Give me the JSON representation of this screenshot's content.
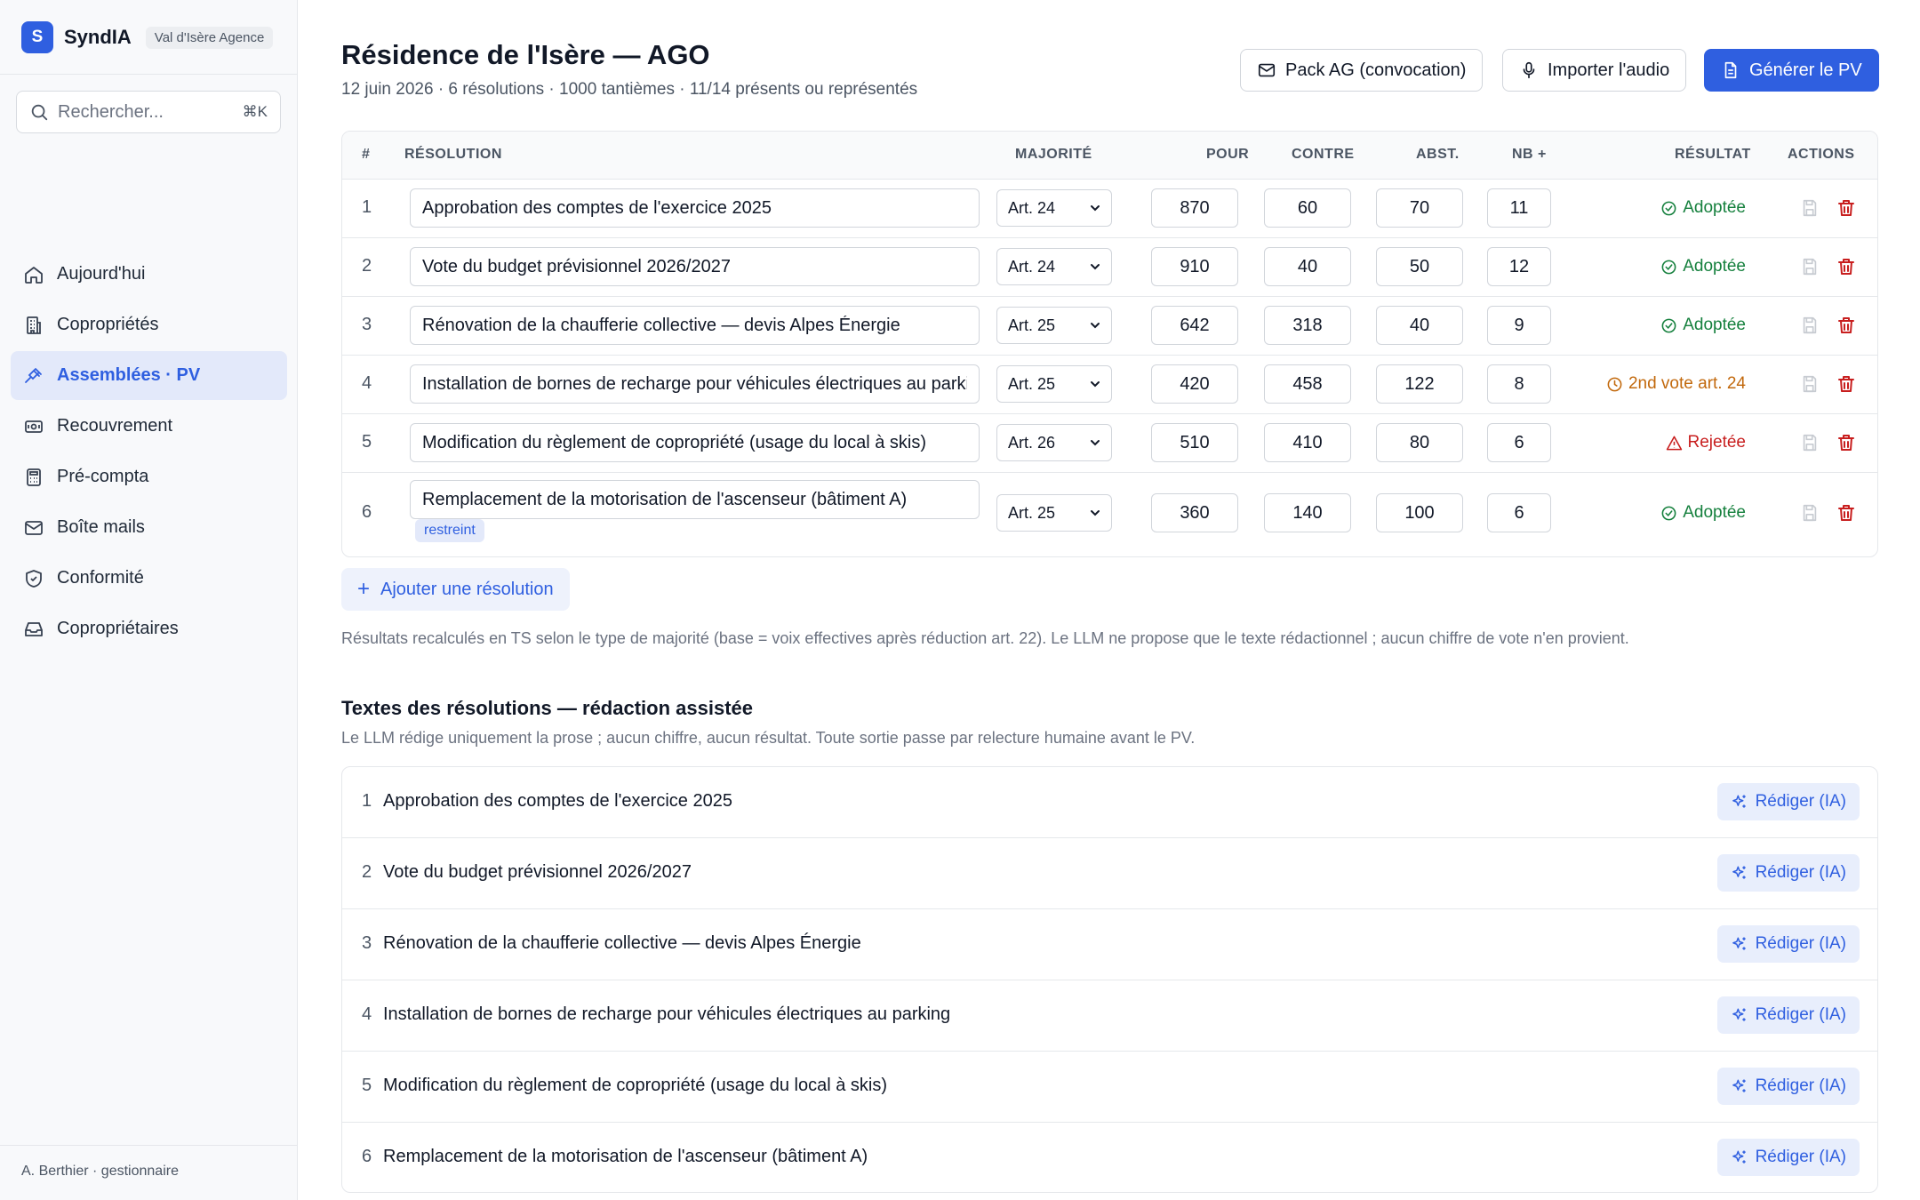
{
  "app": {
    "logo_letter": "S",
    "name": "SyndIA",
    "agency": "Val d'Isère Agence"
  },
  "search": {
    "placeholder": "Rechercher...",
    "shortcut": "⌘K"
  },
  "nav": [
    {
      "label": "Aujourd'hui",
      "icon": "home-icon"
    },
    {
      "label": "Copropriétés",
      "icon": "building-icon"
    },
    {
      "label": "Assemblées · PV",
      "icon": "gavel-icon",
      "active": true
    },
    {
      "label": "Recouvrement",
      "icon": "banknote-icon"
    },
    {
      "label": "Pré-compta",
      "icon": "calculator-icon"
    },
    {
      "label": "Boîte mails",
      "icon": "mail-icon"
    },
    {
      "label": "Conformité",
      "icon": "shield-icon"
    },
    {
      "label": "Copropriétaires",
      "icon": "inbox-icon"
    }
  ],
  "user": "A. Berthier · gestionnaire",
  "header": {
    "title": "Résidence de l'Isère — AGO",
    "subtitle": "12 juin 2026 · 6 résolutions · 1000 tantièmes · 11/14 présents ou représentés",
    "btn_pack": "Pack AG (convocation)",
    "btn_import": "Importer l'audio",
    "btn_generate": "Générer le PV"
  },
  "table": {
    "headers": {
      "num": "#",
      "resolution": "RÉSOLUTION",
      "majorite": "MAJORITÉ",
      "pour": "POUR",
      "contre": "CONTRE",
      "abst": "ABST.",
      "nb": "NB +",
      "resultat": "RÉSULTAT",
      "actions": "ACTIONS"
    },
    "rows": [
      {
        "num": "1",
        "text": "Approbation des comptes de l'exercice 2025",
        "majorite": "Art. 24",
        "pour": "870",
        "contre": "60",
        "abst": "70",
        "nb": "11",
        "result": "Adoptée",
        "status": "adopted"
      },
      {
        "num": "2",
        "text": "Vote du budget prévisionnel 2026/2027",
        "majorite": "Art. 24",
        "pour": "910",
        "contre": "40",
        "abst": "50",
        "nb": "12",
        "result": "Adoptée",
        "status": "adopted"
      },
      {
        "num": "3",
        "text": "Rénovation de la chaufferie collective — devis Alpes Énergie",
        "majorite": "Art. 25",
        "pour": "642",
        "contre": "318",
        "abst": "40",
        "nb": "9",
        "result": "Adoptée",
        "status": "adopted"
      },
      {
        "num": "4",
        "text": "Installation de bornes de recharge pour véhicules électriques au parking",
        "majorite": "Art. 25",
        "pour": "420",
        "contre": "458",
        "abst": "122",
        "nb": "8",
        "result": "2nd vote art. 24",
        "status": "second-vote"
      },
      {
        "num": "5",
        "text": "Modification du règlement de copropriété (usage du local à skis)",
        "majorite": "Art. 26",
        "pour": "510",
        "contre": "410",
        "abst": "80",
        "nb": "6",
        "result": "Rejetée",
        "status": "rejected"
      },
      {
        "num": "6",
        "text": "Remplacement de la motorisation de l'ascenseur (bâtiment A)",
        "majorite": "Art. 25",
        "pour": "360",
        "contre": "140",
        "abst": "100",
        "nb": "6",
        "result": "Adoptée",
        "status": "adopted",
        "tag": "restreint"
      }
    ]
  },
  "add_resolution": "Ajouter une résolution",
  "note": "Résultats recalculés en TS selon le type de majorité (base = voix effectives après réduction art. 22). Le LLM ne propose que le texte rédactionnel ; aucun chiffre de vote n'en provient.",
  "drafting": {
    "title": "Textes des résolutions — rédaction assistée",
    "subtitle": "Le LLM rédige uniquement la prose ; aucun chiffre, aucun résultat. Toute sortie passe par relecture humaine avant le PV.",
    "button_label": "Rédiger (IA)",
    "items": [
      {
        "num": "1",
        "text": "Approbation des comptes de l'exercice 2025"
      },
      {
        "num": "2",
        "text": "Vote du budget prévisionnel 2026/2027"
      },
      {
        "num": "3",
        "text": "Rénovation de la chaufferie collective — devis Alpes Énergie"
      },
      {
        "num": "4",
        "text": "Installation de bornes de recharge pour véhicules électriques au parking"
      },
      {
        "num": "5",
        "text": "Modification du règlement de copropriété (usage du local à skis)"
      },
      {
        "num": "6",
        "text": "Remplacement de la motorisation de l'ascenseur (bâtiment A)"
      }
    ]
  },
  "colors": {
    "accent": "#2f5fe0",
    "adopted": "#15803d",
    "second_vote": "#c2690d",
    "rejected": "#c81e1e",
    "delete": "#c81e1e"
  }
}
